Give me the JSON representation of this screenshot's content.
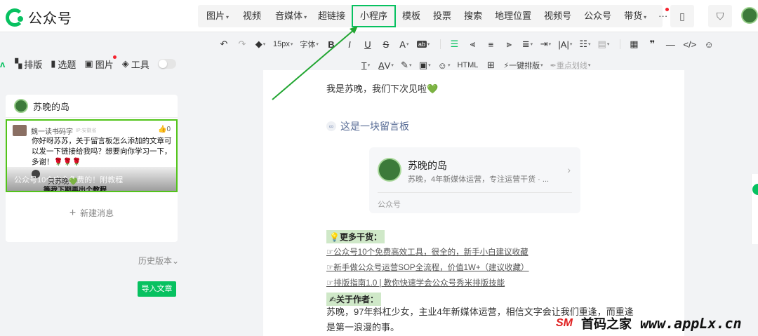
{
  "app": {
    "title": "公众号"
  },
  "topnav": {
    "group1": [
      "图片",
      "视频",
      "音媒体"
    ],
    "group2": [
      "超链接",
      "小程序",
      "模板",
      "投票",
      "搜索",
      "地理位置",
      "视频号",
      "公众号",
      "带货",
      "···"
    ],
    "highlighted": "小程序"
  },
  "toolbar": {
    "row1": {
      "font_size": "15px",
      "font_label": "字体"
    },
    "row2": {
      "one_click": "一键排版",
      "highlight": "重点划线"
    }
  },
  "left_tools": {
    "layout": "排版",
    "topic": "选题",
    "image": "图片",
    "tools": "工具"
  },
  "left_panel": {
    "account_name": "苏晚的岛",
    "message": {
      "user": "魏一读书码字",
      "sub": "IP:安徽省",
      "likes": "0",
      "text": "你好呀苏苏，关于留言板怎么添加的文章可以发一下链接给我吗？想要向你学习一下，多谢！🌹🌹🌹",
      "overlay_title": "公众号10个完全免费的！附教程",
      "reply_user": "只苏晚💚",
      "reply_text": "等我下期再出个教程"
    },
    "new_message": "新建消息"
  },
  "history": "历史版本",
  "import": "导入文章",
  "editor": {
    "greeting": "我是苏晚，我们下次见啦💚",
    "link_title": "这是一块留言板",
    "card": {
      "name": "苏晚的岛",
      "desc": "苏晚，4年新媒体运营，专注运营干货 · ...",
      "footer": "公众号"
    },
    "more_title": "💡更多干货：",
    "links": [
      "☞公众号10个免费高效工具，很全的，新手小白建议收藏",
      "☞新手做公众号运营SOP全流程，价值1W+（建议收藏）",
      "☞排版指南1.0 | 教你快速学会公众号秀米排版技能"
    ],
    "author_title": "✍关于作者：",
    "author_text": "苏晚，97年斜杠少女，主业4年新媒体运营，相信文字会让我们重逢，而重逢是第一浪漫的事。"
  },
  "watermark": {
    "logo": "SM",
    "name": "首码之家",
    "url": "www.appLx.cn"
  },
  "colors": {
    "brand": "#07c160",
    "highlight_border": "#1aad19",
    "link": "#576b95"
  }
}
